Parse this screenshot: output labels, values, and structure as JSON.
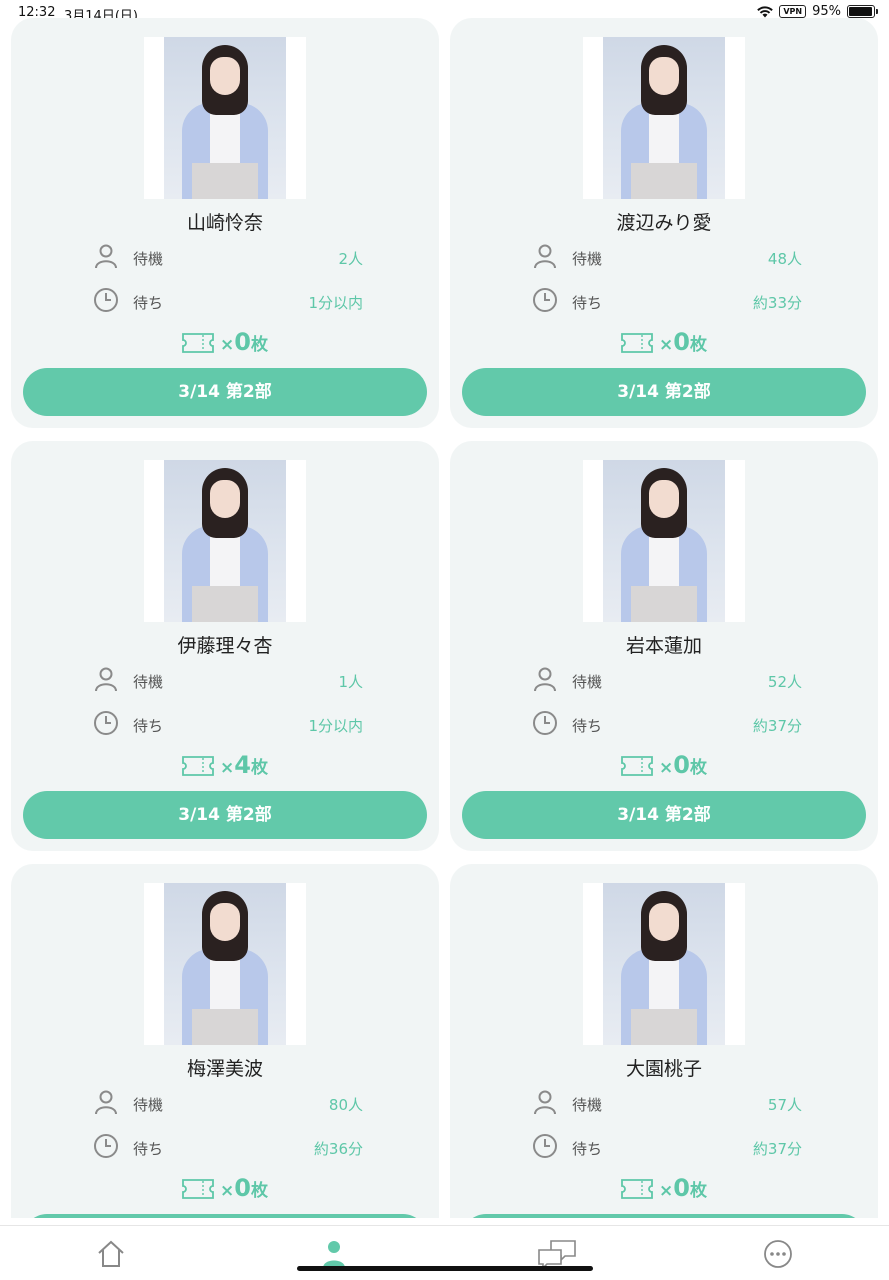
{
  "status_bar": {
    "time": "12:32",
    "date": "3月14日(日)",
    "vpn": "VPN",
    "battery": "95%",
    "battery_level": 0.95,
    "wifi_icon": "wifi-icon"
  },
  "colors": {
    "accent": "#62c9aa",
    "accent_text": "#5ec7a8",
    "card_bg": "#f1f5f5"
  },
  "labels": {
    "waiting": "待機",
    "wait_time": "待ち",
    "multiply": "×",
    "ticket_unit": "枚"
  },
  "members": [
    {
      "name": "山崎怜奈",
      "waiting": "2人",
      "wait_time": "1分以内",
      "tickets": "0",
      "session": "3/14 第2部"
    },
    {
      "name": "渡辺みり愛",
      "waiting": "48人",
      "wait_time": "約33分",
      "tickets": "0",
      "session": "3/14 第2部"
    },
    {
      "name": "伊藤理々杏",
      "waiting": "1人",
      "wait_time": "1分以内",
      "tickets": "4",
      "session": "3/14 第2部"
    },
    {
      "name": "岩本蓮加",
      "waiting": "52人",
      "wait_time": "約37分",
      "tickets": "0",
      "session": "3/14 第2部"
    },
    {
      "name": "梅澤美波",
      "waiting": "80人",
      "wait_time": "約36分",
      "tickets": "0",
      "session": ""
    },
    {
      "name": "大園桃子",
      "waiting": "57人",
      "wait_time": "約37分",
      "tickets": "0",
      "session": ""
    }
  ],
  "tab_bar": {
    "items": [
      {
        "icon": "home-icon",
        "active": false
      },
      {
        "icon": "person-icon",
        "active": true
      },
      {
        "icon": "chat-icon",
        "active": false
      },
      {
        "icon": "more-icon",
        "active": false
      }
    ]
  }
}
